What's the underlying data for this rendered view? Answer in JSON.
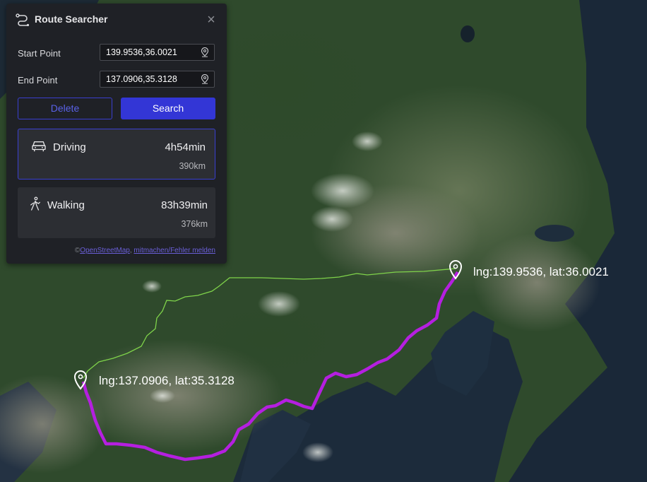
{
  "panel": {
    "title": "Route Searcher",
    "title_icon": "route-icon",
    "close_icon": "close-icon"
  },
  "start_point": {
    "label": "Start Point",
    "value": "139.9536,36.0021",
    "icon": "location-pin-icon"
  },
  "end_point": {
    "label": "End Point",
    "value": "137.0906,35.3128",
    "icon": "location-pin-icon"
  },
  "buttons": {
    "delete_label": "Delete",
    "search_label": "Search"
  },
  "routes": [
    {
      "mode": "Driving",
      "icon": "car-icon",
      "duration": "4h54min",
      "distance": "390km",
      "selected": true
    },
    {
      "mode": "Walking",
      "icon": "walking-icon",
      "duration": "83h39min",
      "distance": "376km",
      "selected": false
    }
  ],
  "attribution": {
    "prefix": "©",
    "osm_link": "OpenStreetMap",
    "separator": ", ",
    "edit_link": "mitmachen/Fehler melden"
  },
  "map_markers": [
    {
      "label": "lng:139.9536, lat:36.0021"
    },
    {
      "label": "lng:137.0906, lat:35.3128"
    }
  ],
  "colors": {
    "driving_route": "#b51fe0",
    "walking_route": "#7fd34a",
    "accent": "#3336d6",
    "panel_bg": "#1f2126"
  }
}
